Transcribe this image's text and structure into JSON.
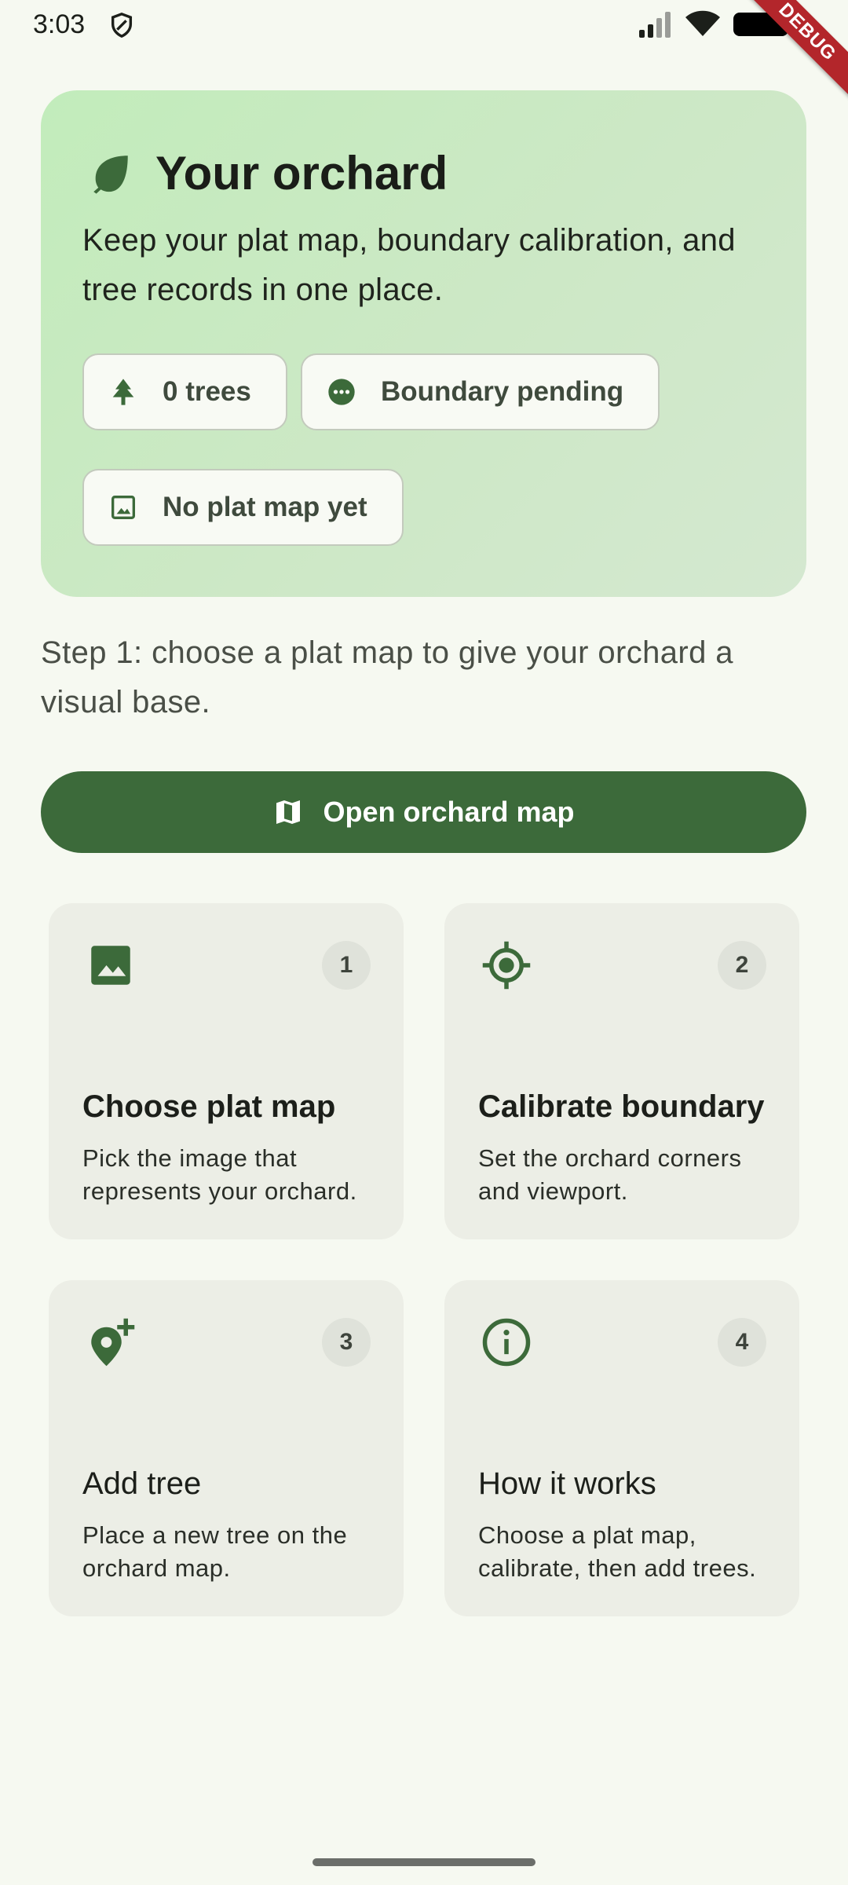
{
  "status_bar": {
    "time": "3:03",
    "debug_label": "DEBUG"
  },
  "hero": {
    "title": "Your orchard",
    "description": "Keep your plat map, boundary calibration, and tree records in one place.",
    "chips": {
      "trees": "0 trees",
      "boundary": "Boundary pending",
      "plat_map": "No plat map yet"
    }
  },
  "step_text": "Step 1: choose a plat map to give your orchard a visual base.",
  "open_map_button": "Open orchard map",
  "cards": [
    {
      "number": "1",
      "title": "Choose plat map",
      "description": "Pick the image that represents your orchard.",
      "icon": "image-icon"
    },
    {
      "number": "2",
      "title": "Calibrate boundary",
      "description": "Set the orchard corners and viewport.",
      "icon": "gps-target-icon"
    },
    {
      "number": "3",
      "title": "Add tree",
      "description": "Place a new tree on the orchard map.",
      "icon": "add-location-icon"
    },
    {
      "number": "4",
      "title": "How it works",
      "description": "Choose a plat map, calibrate, then add trees.",
      "icon": "info-icon"
    }
  ],
  "colors": {
    "primary": "#3c6a3a",
    "background": "#f6f9f1",
    "hero_gradient_start": "#c2ecbb",
    "card_background": "#eceee6"
  }
}
